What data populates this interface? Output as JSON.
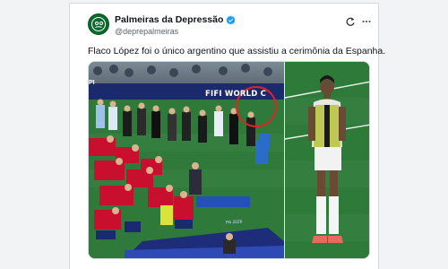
{
  "post": {
    "display_name": "Palmeiras da Depressão",
    "handle": "@deprepalmeiras",
    "text": "Flaco López foi o único argentino que assistiu a cerimônia da Espanha.",
    "verified": true
  },
  "icons": {
    "avatar": "palmeiras-logo-avatar",
    "verified": "verified-badge-icon",
    "refresh": "grok-refresh-icon",
    "more": "more-options-icon"
  },
  "media": {
    "banner_left": "PI",
    "banner_main": "FIFI WORLD C",
    "board_text": "PA 2026"
  },
  "colors": {
    "verified": "#1d9bf0",
    "pitch": "#2f7a3a",
    "spain_red": "#c8102e",
    "highlight_circle": "#e02424"
  }
}
